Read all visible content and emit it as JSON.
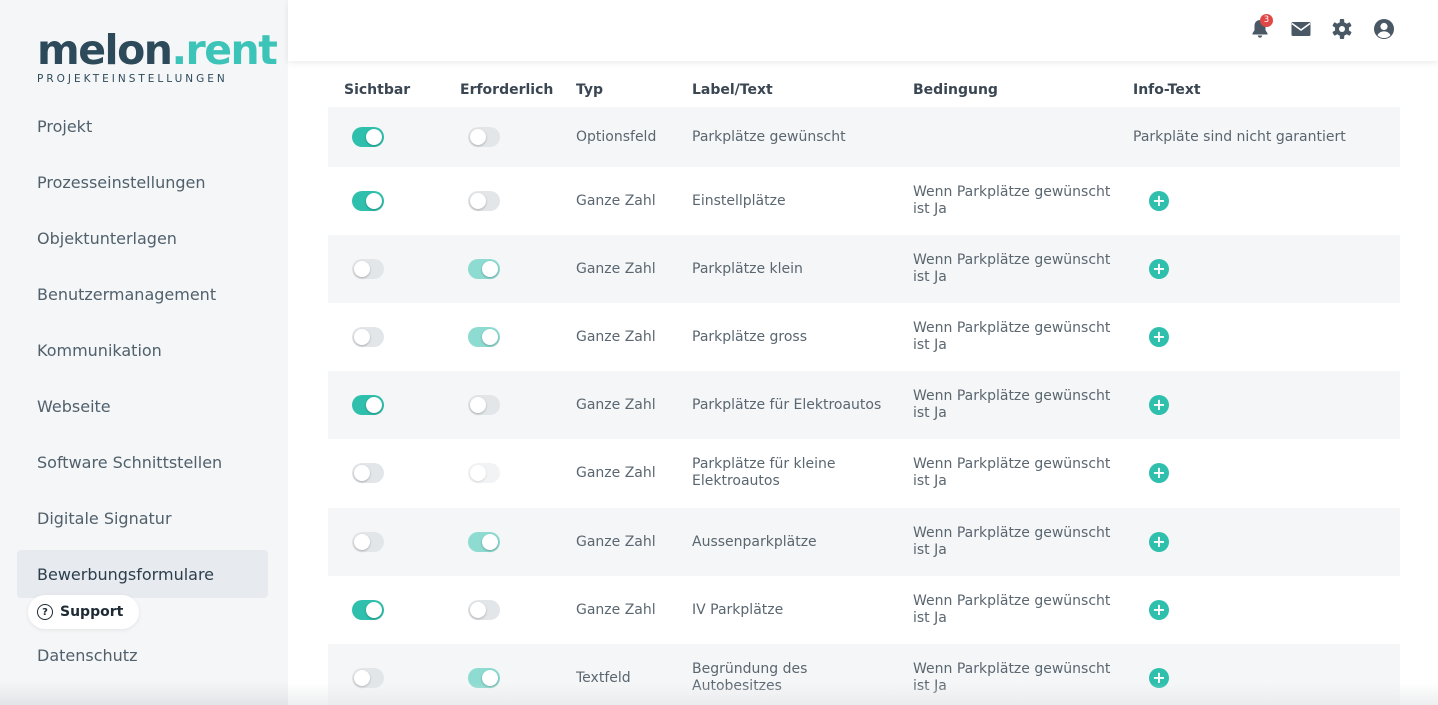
{
  "logo": {
    "main": "melon",
    "accent": ".rent",
    "subtitle": "PROJEKTEINSTELLUNGEN"
  },
  "sidebar": {
    "items": [
      {
        "label": "Projekt"
      },
      {
        "label": "Prozesseinstellungen"
      },
      {
        "label": "Objektunterlagen"
      },
      {
        "label": "Benutzermanagement"
      },
      {
        "label": "Kommunikation"
      },
      {
        "label": "Webseite"
      },
      {
        "label": "Software Schnittstellen"
      },
      {
        "label": "Digitale Signatur"
      },
      {
        "label": "Bewerbungsformulare",
        "active": true
      },
      {
        "label": "Datenschutz"
      }
    ],
    "support_label": "Support"
  },
  "header": {
    "notification_count": "3",
    "icons": [
      "bell-icon",
      "mail-icon",
      "gear-icon",
      "user-icon"
    ]
  },
  "table": {
    "headers": [
      "Sichtbar",
      "Erforderlich",
      "Typ",
      "Label/Text",
      "Bedingung",
      "Info-Text"
    ],
    "rows": [
      {
        "visible": "on",
        "required": "off",
        "type": "Optionsfeld",
        "label": "Parkplätze gewünscht",
        "condition": "",
        "info": "Parkpläte sind nicht garantiert",
        "info_button": false
      },
      {
        "visible": "on",
        "required": "off",
        "type": "Ganze Zahl",
        "label": "Einstellplätze",
        "condition": "Wenn Parkplätze gewünscht ist Ja",
        "info": "",
        "info_button": true
      },
      {
        "visible": "off",
        "required": "on",
        "type": "Ganze Zahl",
        "label": "Parkplätze klein",
        "condition": "Wenn Parkplätze gewünscht ist Ja",
        "info": "",
        "info_button": true
      },
      {
        "visible": "off",
        "required": "on",
        "type": "Ganze Zahl",
        "label": "Parkplätze gross",
        "condition": "Wenn Parkplätze gewünscht ist Ja",
        "info": "",
        "info_button": true
      },
      {
        "visible": "on",
        "required": "off",
        "type": "Ganze Zahl",
        "label": "Parkplätze für Elektroautos",
        "condition": "Wenn Parkplätze gewünscht ist Ja",
        "info": "",
        "info_button": true
      },
      {
        "visible": "off",
        "required": "off",
        "type": "Ganze Zahl",
        "label": "Parkplätze für kleine Elektroautos",
        "condition": "Wenn Parkplätze gewünscht ist Ja",
        "info": "",
        "info_button": true
      },
      {
        "visible": "off",
        "required": "on",
        "type": "Ganze Zahl",
        "label": "Aussenparkplätze",
        "condition": "Wenn Parkplätze gewünscht ist Ja",
        "info": "",
        "info_button": true
      },
      {
        "visible": "on",
        "required": "off",
        "type": "Ganze Zahl",
        "label": "IV Parkplätze",
        "condition": "Wenn Parkplätze gewünscht ist Ja",
        "info": "",
        "info_button": true
      },
      {
        "visible": "off",
        "required": "on",
        "type": "Textfeld",
        "label": "Begründung des Autobesitzes",
        "condition": "Wenn Parkplätze gewünscht ist Ja",
        "info": "",
        "info_button": true
      }
    ]
  },
  "colors": {
    "accent": "#2fbfad",
    "brand_dark": "#2d4a5a",
    "brand_accent": "#3cc4b8",
    "badge": "#e04848"
  }
}
